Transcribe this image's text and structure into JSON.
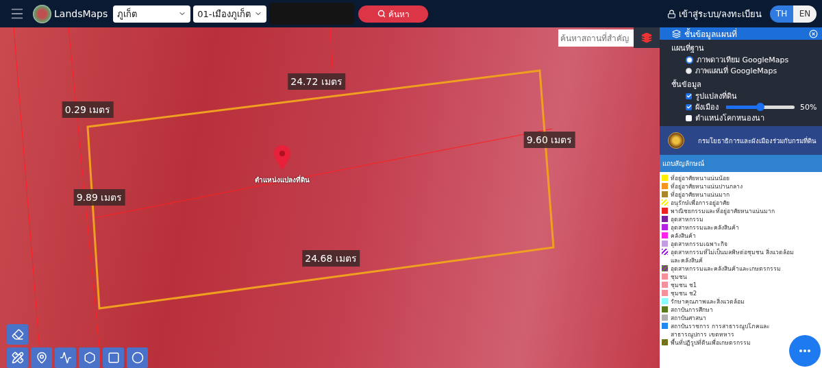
{
  "header": {
    "brand": "LandsMaps",
    "province": "ภูเก็ต",
    "district": "01-เมืองภูเก็ต",
    "search_button": "ค้นหา",
    "login": "เข้าสู่ระบบ/ลงทะเบียน",
    "languages": [
      {
        "label": "TH",
        "selected": true
      },
      {
        "label": "EN",
        "selected": false
      }
    ]
  },
  "map": {
    "place_search": {
      "placeholder": "ค้นหาสถานที่สำคัญ"
    },
    "parcel_label": "ตำแหน่งแปลงที่ดิน",
    "measurements": [
      "24.72 เมตร",
      "0.29 เมตร",
      "9.60 เมตร",
      "9.89 เมตร",
      "24.68 เมตร"
    ]
  },
  "layers_panel": {
    "title": "ชั้นข้อมูลแผนที่",
    "base_heading": "แผนที่ฐาน",
    "base_maps": [
      {
        "label": "ภาพดาวเทียม GoogleMaps",
        "selected": true
      },
      {
        "label": "ภาพแผนที่ GoogleMaps",
        "selected": false
      }
    ],
    "layers_heading": "ชั้นข้อมูล",
    "layers": [
      {
        "label": "รูปแปลงที่ดิน",
        "checked": true
      },
      {
        "label": "ผังเมือง",
        "checked": true,
        "level": 0.5,
        "reading": "50%"
      },
      {
        "label": "ตำแหน่งโคกหนองนา",
        "checked": false
      }
    ]
  },
  "banner": {
    "title": "กรมโยธาธิการและผังเมืองร่วมกับกรมที่ดิน"
  },
  "legend": {
    "title": "แถบสัญลักษณ์",
    "items": [
      {
        "label": "ที่อยู่อาศัยหนาแน่นน้อย",
        "kind": "solid",
        "color": "#ffee00"
      },
      {
        "label": "ที่อยู่อาศัยหนาแน่นปานกลาง",
        "kind": "solid",
        "color": "#f7941d"
      },
      {
        "label": "ที่อยู่อาศัยหนาแน่นมาก",
        "kind": "solid",
        "color": "#a8862a"
      },
      {
        "label": "อนุรักษ์เพื่อการอยู่อาศัย",
        "kind": "hatched",
        "color": "#ffee00"
      },
      {
        "label": "พาณิชยกรรมและที่อยู่อาศัยหนาแน่นมาก",
        "kind": "solid",
        "color": "#ee2222"
      },
      {
        "label": "อุตสาหกรรม",
        "kind": "solid",
        "color": "#7b1fa2"
      },
      {
        "label": "อุตสาหกรรมและคลังสินค้า",
        "kind": "solid",
        "color": "#b620e0"
      },
      {
        "label": "คลังสินค้า",
        "kind": "solid",
        "color": "#ff22ee"
      },
      {
        "label": "อุตสาหกรรมเฉพาะกิจ",
        "kind": "solid",
        "color": "#c39be0"
      },
      {
        "label": "อุตสาหกรรมที่ไม่เป็นมลพิษต่อชุมชน สิ่งแวดล้อมและคลังสินค้",
        "kind": "hatched",
        "color": "#9b20e0"
      },
      {
        "label": "อุตสาหกรรมและคลังสินค้าและเกษตรกรรม",
        "kind": "farmhatched",
        "color": "#8a2ab0"
      },
      {
        "label": "ชุมชน",
        "kind": "solid",
        "color": "#f4909c"
      },
      {
        "label": "ชุมชน ช1",
        "kind": "solid",
        "color": "#f4909c"
      },
      {
        "label": "ชุมชน ช2",
        "kind": "solid",
        "color": "#f4909c"
      },
      {
        "label": "รักษาคุณภาพและสิ่งแวดล้อม",
        "kind": "solid",
        "color": "#88ffff"
      },
      {
        "label": "สถาบันการศึกษา",
        "kind": "solid",
        "color": "#5b7a1c"
      },
      {
        "label": "สถาบันศาสนา",
        "kind": "solid",
        "color": "#b0aeae"
      },
      {
        "label": "สถาบันราชการ การสาธารณูปโภคและสาธารณูปการ เขตทหาร",
        "kind": "solid",
        "color": "#2088ee"
      },
      {
        "label": "พื้นที่ปฏิรูปที่ดินเพื่อเกษตรกรรม",
        "kind": "farmhatched",
        "color": "#8a5a1a"
      }
    ]
  }
}
